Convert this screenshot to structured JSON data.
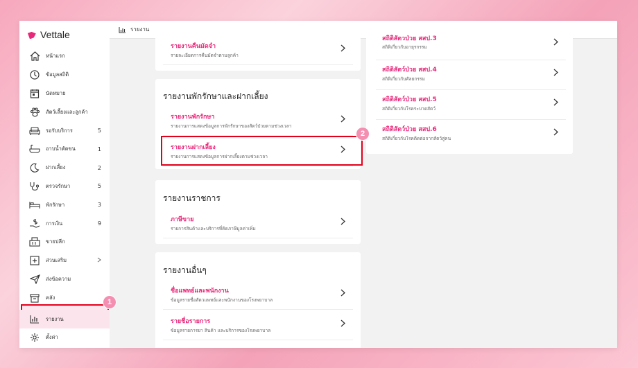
{
  "app": {
    "name": "Vettale",
    "brand_color": "#e8287a"
  },
  "topbar": {
    "icon": "bar-chart-icon",
    "title": "รายงาน"
  },
  "sidebar": {
    "items": [
      {
        "label": "หน้าแรก",
        "icon": "home-icon",
        "count": ""
      },
      {
        "label": "ข้อมูลสถิติ",
        "icon": "clock-icon",
        "count": ""
      },
      {
        "label": "นัดหมาย",
        "icon": "calendar-icon",
        "count": ""
      },
      {
        "label": "สัตว์เลี้ยงและลูกค้า",
        "icon": "paw-icon",
        "count": ""
      },
      {
        "label": "รอรับบริการ",
        "icon": "sofa-icon",
        "count": "5"
      },
      {
        "label": "อาบน้ำตัดขน",
        "icon": "bathtub-icon",
        "count": "1"
      },
      {
        "label": "ฝากเลี้ยง",
        "icon": "moon-icon",
        "count": "2"
      },
      {
        "label": "ตรวจรักษา",
        "icon": "stethoscope-icon",
        "count": "5"
      },
      {
        "label": "พักรักษา",
        "icon": "bed-icon",
        "count": "3"
      },
      {
        "label": "การเงิน",
        "icon": "money-icon",
        "count": "9"
      },
      {
        "label": "ขายปลีก",
        "icon": "register-icon",
        "count": ""
      },
      {
        "label": "ส่วนเสริม",
        "icon": "plus-box-icon",
        "count": ""
      },
      {
        "label": "ส่งข้อความ",
        "icon": "send-icon",
        "count": ""
      },
      {
        "label": "คลัง",
        "icon": "box-icon",
        "count": ""
      },
      {
        "label": "รายงาน",
        "icon": "bar-chart-icon",
        "count": ""
      },
      {
        "label": "ตั้งค่า",
        "icon": "gear-icon",
        "count": ""
      }
    ]
  },
  "steps": {
    "one": "1",
    "two": "2"
  },
  "cards": {
    "top_partial": {
      "row": {
        "title": "รายงานคืนมัดจำ",
        "subtitle": "รายละเอียดการคืนมัดจำตามลูกค้า"
      }
    },
    "boarding": {
      "title": "รายงานพักรักษาและฝากเลี้ยง",
      "rows": [
        {
          "title": "รายงานพักรักษา",
          "subtitle": "รายงานการแสดงข้อมูลการพักรักษาของสัตว์ป่วยตามช่วงเวลา"
        },
        {
          "title": "รายงานฝากเลี้ยง",
          "subtitle": "รายงานการแสดงข้อมูลการฝากเลี้ยงตามช่วงเวลา"
        }
      ]
    },
    "government": {
      "title": "รายงานราชการ",
      "rows": [
        {
          "title": "ภาษีขาย",
          "subtitle": "รายการสินค้าและบริการที่คิดภาษีมูลค่าเพิ่ม"
        }
      ]
    },
    "other": {
      "title": "รายงานอื่นๆ",
      "rows": [
        {
          "title": "ชื่อแพทย์และพนักงาน",
          "subtitle": "ข้อมูลรายชื่อสัตวแพทย์และพนักงานของโรงพยาบาล"
        },
        {
          "title": "รายชื่อรายการ",
          "subtitle": "ข้อมูลรายการยา สินค้า และบริการของโรงพยาบาล"
        }
      ]
    },
    "right": {
      "rows": [
        {
          "title": "สถิติสัตวป่วย สสป.3",
          "subtitle": "สถิติเกี่ยวกับอายุรกรรม"
        },
        {
          "title": "สถิติสัตว์ป่วย สสป.4",
          "subtitle": "สถิติเกี่ยวกับศัลยกรรม"
        },
        {
          "title": "สถิติสัตว์ป่วย สสป.5",
          "subtitle": "สถิติเกี่ยวกับโรคระบาดสัตว์"
        },
        {
          "title": "สถิติสัตว์ป่วย สสป.6",
          "subtitle": "สถิติเกี่ยวกับโรคติดต่อจากสัตว์สู่คน"
        }
      ]
    }
  }
}
